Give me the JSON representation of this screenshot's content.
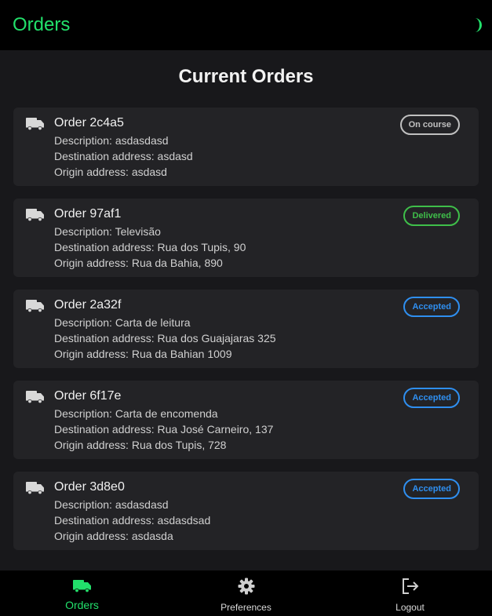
{
  "colors": {
    "accent": "#22e06b",
    "background": "#18181b",
    "card": "#232326",
    "bar": "#000000"
  },
  "header": {
    "title": "Orders",
    "theme_toggle_icon": "half-moon-icon"
  },
  "main": {
    "title": "Current Orders",
    "description_label": "Description: ",
    "destination_label": "Destination address: ",
    "origin_label": "Origin address: ",
    "orders": [
      {
        "title": "Order 2c4a5",
        "description": "asdasdasd",
        "destination": "asdasd",
        "origin": "asdasd",
        "status": "On course",
        "status_color": "#c0c0c0"
      },
      {
        "title": "Order 97af1",
        "description": "Televisão",
        "destination": "Rua dos Tupis, 90",
        "origin": "Rua da Bahia, 890",
        "status": "Delivered",
        "status_color": "#3fbf4a"
      },
      {
        "title": "Order 2a32f",
        "description": "Carta de leitura",
        "destination": "Rua dos Guajajaras 325",
        "origin": "Rua da Bahian 1009",
        "status": "Accepted",
        "status_color": "#2f8ff0"
      },
      {
        "title": "Order 6f17e",
        "description": "Carta de encomenda",
        "destination": "Rua José Carneiro, 137",
        "origin": "Rua dos Tupis, 728",
        "status": "Accepted",
        "status_color": "#2f8ff0"
      },
      {
        "title": "Order 3d8e0",
        "description": "asdasdasd",
        "destination": "asdasdsad",
        "origin": "asdasda",
        "status": "Accepted",
        "status_color": "#2f8ff0"
      }
    ]
  },
  "bottom_nav": {
    "items": [
      {
        "label": "Orders",
        "icon": "truck-icon",
        "active": true
      },
      {
        "label": "Preferences",
        "icon": "gear-icon",
        "active": false
      },
      {
        "label": "Logout",
        "icon": "logout-icon",
        "active": false
      }
    ]
  }
}
